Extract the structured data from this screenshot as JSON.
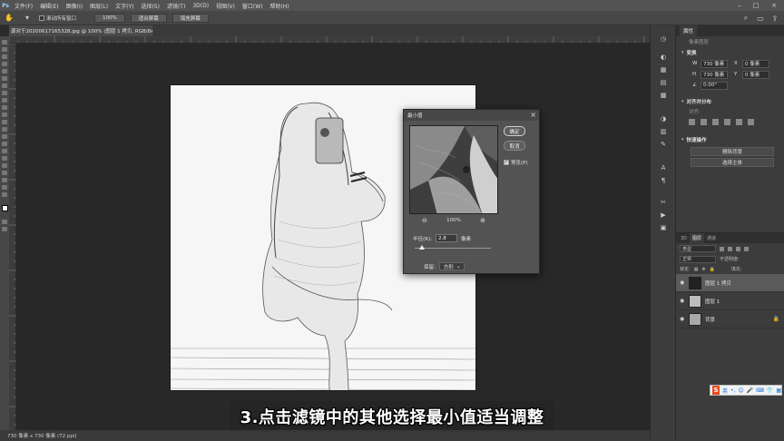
{
  "menubar": {
    "logo": "Ps",
    "items": [
      "文件(F)",
      "编辑(E)",
      "图像(I)",
      "图层(L)",
      "文字(Y)",
      "选择(S)",
      "滤镜(T)",
      "3D(D)",
      "视图(V)",
      "窗口(W)",
      "帮助(H)"
    ]
  },
  "optionsbar": {
    "scroll_all_label": "滚动所有窗口",
    "zoom_100": "100%",
    "fit_screen": "适合屏幕",
    "fill_screen": "填充屏幕"
  },
  "document": {
    "tab_title": "源对于20200617165328.jpg @ 100% (图层 1 拷贝, RGB/8#) *",
    "tab_close": "×"
  },
  "statusbar": {
    "info": "730 像素 x 730 像素 (72 ppi)"
  },
  "caption": {
    "text": "3.点击滤镜中的其他选择最小值适当调整"
  },
  "dialog": {
    "title": "最小值",
    "ok": "确定",
    "cancel": "取消",
    "preview_label": "预览(P)",
    "preview_checked": true,
    "zoom": "100%",
    "radius_label": "半径(R):",
    "radius_value": "2.8",
    "radius_unit": "像素",
    "radius_fraction": 0.1,
    "keep_label": "保留:",
    "keep_value": "方形"
  },
  "panels": {
    "properties_tab": "属性",
    "properties_sub": "像素图层",
    "transform_title": "变换",
    "w_label": "W",
    "w_value": "730 像素",
    "h_label": "H",
    "h_value": "730 像素",
    "x_label": "X",
    "x_value": "0 像素",
    "y_label": "Y",
    "y_value": "0 像素",
    "angle_value": "0.00°",
    "align_title": "对齐并分布",
    "align_sub": "对齐:",
    "quick_title": "快速操作",
    "remove_bg": "删除背景",
    "select_subject": "选择主体"
  },
  "layers": {
    "tabs": [
      "3D",
      "图层",
      "通道"
    ],
    "active_tab": "图层",
    "filter_label": "类型",
    "blend_mode": "正常",
    "opacity_label": "不透明度:",
    "lock_label": "锁定:",
    "fill_label": "填充:",
    "items": [
      {
        "name": "图层 1 拷贝",
        "selected": true,
        "locked": false
      },
      {
        "name": "图层 1",
        "selected": false,
        "locked": false
      },
      {
        "name": "背景",
        "selected": false,
        "locked": true
      }
    ]
  },
  "ime": {
    "logo": "S",
    "lang": "英"
  }
}
